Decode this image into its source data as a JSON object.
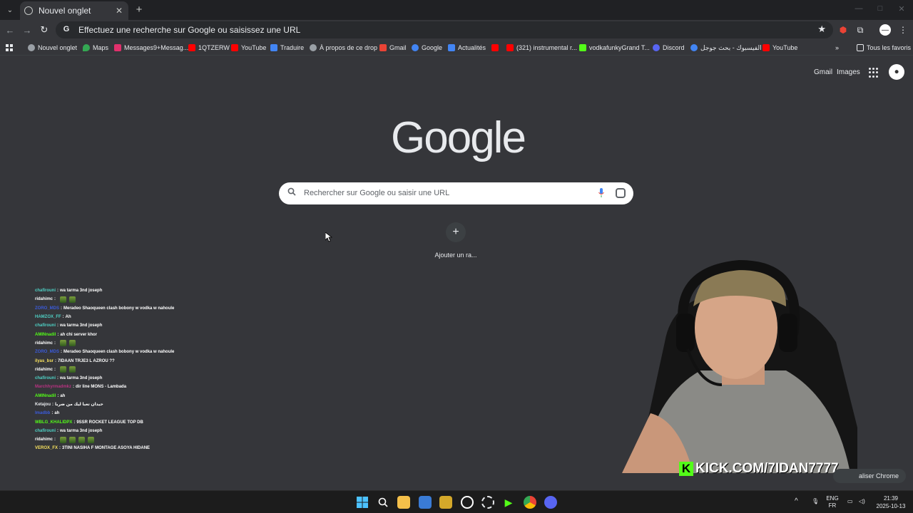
{
  "tab": {
    "title": "Nouvel onglet",
    "close": "✕",
    "new": "+"
  },
  "window": {
    "min": "—",
    "max": "□",
    "close": "✕"
  },
  "toolbar": {
    "back": "←",
    "forward": "→",
    "reload": "↻",
    "omnibox_text": "Effectuez une recherche sur Google ou saisissez une URL",
    "star": "★"
  },
  "bookmarks": {
    "apps_label": "",
    "items": [
      {
        "label": "Nouvel onglet",
        "color": "#9aa0a6"
      },
      {
        "label": "Maps",
        "color": "#34a853"
      },
      {
        "label": "Messages9+Messag...",
        "color": "#e1306c"
      },
      {
        "label": "1QTZERW",
        "color": "#ff0000"
      },
      {
        "label": "YouTube",
        "color": "#ff0000"
      },
      {
        "label": "Traduire",
        "color": "#4285f4"
      },
      {
        "label": "À propos de ce drop",
        "color": "#9aa0a6"
      },
      {
        "label": "Gmail",
        "color": "#ea4335"
      },
      {
        "label": "Google",
        "color": "#4285f4"
      },
      {
        "label": "Actualités",
        "color": "#4285f4"
      },
      {
        "label": "",
        "color": "#ff0000"
      },
      {
        "label": "(321) instrumental r...",
        "color": "#ff0000"
      },
      {
        "label": "vodkafunkyGrand T...",
        "color": "#53fc18"
      },
      {
        "label": "Discord",
        "color": "#5865f2"
      },
      {
        "label": "الفيسبوك - بحث جوجل",
        "color": "#4285f4"
      },
      {
        "label": "YouTube",
        "color": "#ff0000"
      }
    ],
    "more": "»",
    "all_favorites": "Tous les favoris"
  },
  "google": {
    "gmail": "Gmail",
    "images": "Images",
    "logo": "Google",
    "search_placeholder": "Rechercher sur Google ou saisir une URL",
    "shortcut_add": "+",
    "shortcut_label": "Ajouter un ra...",
    "customize": "aliser Chrome"
  },
  "chat": [
    {
      "user": "chafirouni",
      "color": "#4fd1c5",
      "msg": "wa tarma 3nd joseph",
      "emotes": 0
    },
    {
      "user": "ridahimc",
      "color": "#ffffff",
      "msg": "",
      "emotes": 2
    },
    {
      "user": "ZORO_MDS",
      "color": "#3b5bdb",
      "msg": "Meradeo Shaoqueen clash bobony w vodka w nahoule",
      "emotes": 0
    },
    {
      "user": "HAMZOX_FF",
      "color": "#4fd1c5",
      "msg": "Ah",
      "emotes": 0
    },
    {
      "user": "chafirouni",
      "color": "#4fd1c5",
      "msg": "wa tarma 3nd joseph",
      "emotes": 0
    },
    {
      "user": "AMINnadil",
      "color": "#53fc18",
      "msg": "ah chi server khor",
      "emotes": 0
    },
    {
      "user": "ridahimc",
      "color": "#ffffff",
      "msg": "",
      "emotes": 2
    },
    {
      "user": "ZORO_MDS",
      "color": "#3b5bdb",
      "msg": "Meradeo Shaoqueen clash bobony w vodka w nahoule",
      "emotes": 0
    },
    {
      "user": "ilyas_bsr",
      "color": "#f6e05e",
      "msg": "7IDAAN TRJE3 L AZROU ??",
      "emotes": 0
    },
    {
      "user": "ridahimc",
      "color": "#ffffff",
      "msg": "",
      "emotes": 2
    },
    {
      "user": "chafirouni",
      "color": "#4fd1c5",
      "msg": "wa tarma 3nd joseph",
      "emotes": 0
    },
    {
      "user": "Marchhyrmadmkz",
      "color": "#b83280",
      "msg": "dir line MONS - Lambada",
      "emotes": 0
    },
    {
      "user": "AMINnadil",
      "color": "#53fc18",
      "msg": "ah",
      "emotes": 0
    },
    {
      "user": "Ketajou",
      "color": "#e8eaed",
      "msg": "حيدان تعبا ليك من ضربا",
      "emotes": 0
    },
    {
      "user": "Imadbb",
      "color": "#3b5bdb",
      "msg": "ah",
      "emotes": 0
    },
    {
      "user": "WBLG_KHALIDPX",
      "color": "#53fc18",
      "msg": "9SSR ROCKET LEAGUE TOP DB",
      "emotes": 0
    },
    {
      "user": "chafirouni",
      "color": "#4fd1c5",
      "msg": "wa tarma 3nd joseph",
      "emotes": 0
    },
    {
      "user": "ridahimc",
      "color": "#ffffff",
      "msg": "",
      "emotes": 4
    },
    {
      "user": "VEROX_FX",
      "color": "#f6e05e",
      "msg": "3TINI NASIHA F MONTAGE ASOYA HIDANE",
      "emotes": 0
    }
  ],
  "stream": {
    "kick_logo": "K",
    "kick_url": "KICK.COM/7IDAN7777"
  },
  "taskbar": {
    "lang_top": "ENG",
    "lang_bottom": "FR",
    "time": "21:39",
    "date": "2025-10-13",
    "tray_chevron": "^"
  }
}
